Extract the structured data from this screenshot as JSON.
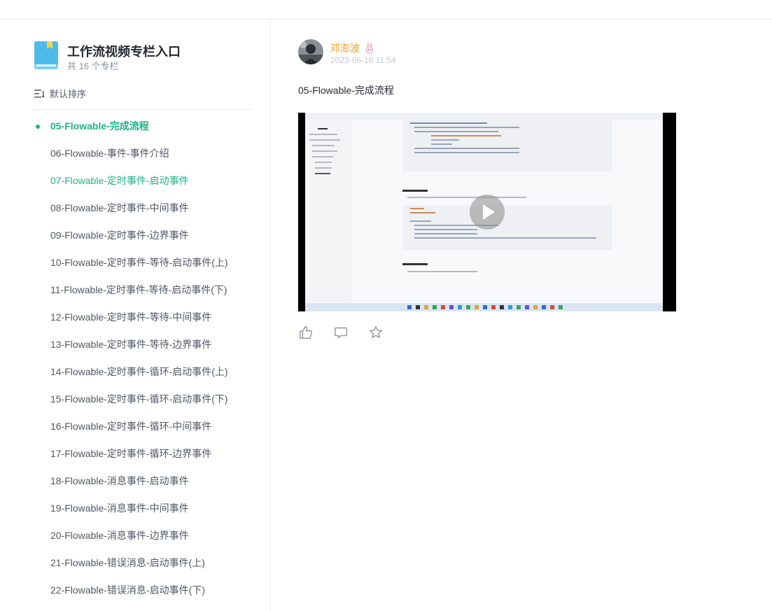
{
  "column": {
    "title": "工作流视频专栏入口",
    "count": "共 16 个专栏",
    "sort_label": "默认排序",
    "icon": "book-icon"
  },
  "articles": [
    {
      "label": "05-Flowable-完成流程",
      "state": "active"
    },
    {
      "label": "06-Flowable-事件-事件介绍",
      "state": "normal"
    },
    {
      "label": "07-Flowable-定时事件-启动事件",
      "state": "visited"
    },
    {
      "label": "08-Flowable-定时事件-中间事件",
      "state": "normal"
    },
    {
      "label": "09-Flowable-定时事件-边界事件",
      "state": "normal"
    },
    {
      "label": "10-Flowable-定时事件-等待-启动事件(上)",
      "state": "normal"
    },
    {
      "label": "11-Flowable-定时事件-等待-启动事件(下)",
      "state": "normal"
    },
    {
      "label": "12-Flowable-定时事件-等待-中间事件",
      "state": "normal"
    },
    {
      "label": "13-Flowable-定时事件-等待-边界事件",
      "state": "normal"
    },
    {
      "label": "14-Flowable-定时事件-循环-启动事件(上)",
      "state": "normal"
    },
    {
      "label": "15-Flowable-定时事件-循环-启动事件(下)",
      "state": "normal"
    },
    {
      "label": "16-Flowable-定时事件-循环-中间事件",
      "state": "normal"
    },
    {
      "label": "17-Flowable-定时事件-循环-边界事件",
      "state": "normal"
    },
    {
      "label": "18-Flowable-消息事件-启动事件",
      "state": "normal"
    },
    {
      "label": "19-Flowable-消息事件-中间事件",
      "state": "normal"
    },
    {
      "label": "20-Flowable-消息事件-边界事件",
      "state": "normal"
    },
    {
      "label": "21-Flowable-错误消息-启动事件(上)",
      "state": "normal"
    },
    {
      "label": "22-Flowable-错误消息-启动事件(下)",
      "state": "normal"
    }
  ],
  "post": {
    "author": "邓澎波",
    "author_badge_icon": "rabbit-icon",
    "date": "2023-06-16 11:54",
    "title": "05-Flowable-完成流程",
    "video": {
      "sections": [
        "3.2 启动流程",
        "3.3 处理流程"
      ],
      "play_icon": "play-icon"
    },
    "actions": [
      "like-icon",
      "comment-icon",
      "star-icon"
    ]
  },
  "colors": {
    "accent": "#1fb489",
    "author": "#f0a020",
    "text": "#515767"
  }
}
